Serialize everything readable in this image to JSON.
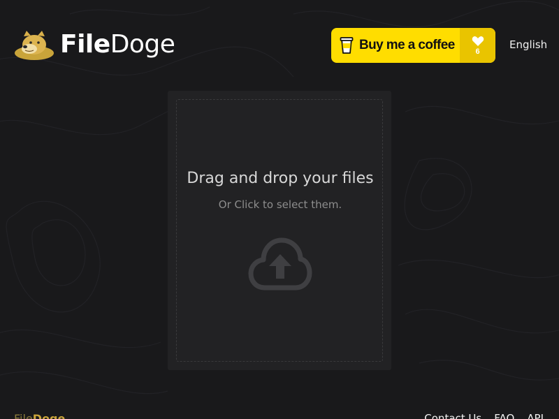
{
  "header": {
    "logo": {
      "part1": "File",
      "part2": "Doge"
    },
    "coffee_button": {
      "label": "Buy me a coffee",
      "count": "6",
      "icon": "coffee-cup-icon",
      "heart_icon": "heart-icon"
    },
    "language": "English"
  },
  "dropzone": {
    "title": "Drag and drop your files",
    "subtitle": "Or Click to select them.",
    "icon": "cloud-upload-icon"
  },
  "footer": {
    "brand": {
      "part1": "File",
      "part2": "Doge"
    },
    "links": [
      "Contact Us",
      "FAQ",
      "API"
    ]
  },
  "colors": {
    "background": "#19191b",
    "panel": "#222224",
    "accent_yellow": "#ffdd00",
    "accent_yellow_dark": "#e9c400",
    "doge_gold": "#c9a43a"
  }
}
